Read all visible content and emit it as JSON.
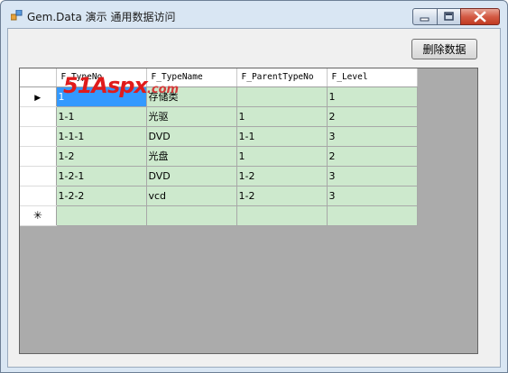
{
  "window": {
    "title": "Gem.Data 演示 通用数据访问",
    "icon": "app-icon",
    "controls": [
      "minimize-icon",
      "maximize-icon",
      "close-icon"
    ]
  },
  "toolbar": {
    "delete_label": "删除数据"
  },
  "grid": {
    "columns": [
      "F_TypeNo",
      "F_TypeName",
      "F_ParentTypeNo",
      "F_Level"
    ],
    "current_row_marker": "▶",
    "new_row_marker": "✳",
    "rows": [
      [
        "1",
        "存储类",
        "",
        "1"
      ],
      [
        "1-1",
        "光驱",
        "1",
        "2"
      ],
      [
        "1-1-1",
        "DVD",
        "1-1",
        "3"
      ],
      [
        "1-2",
        "光盘",
        "1",
        "2"
      ],
      [
        "1-2-1",
        "DVD",
        "1-2",
        "3"
      ],
      [
        "1-2-2",
        "vcd",
        "1-2",
        "3"
      ]
    ]
  },
  "watermark": {
    "brand": "51Aspx",
    "suffix": ".com"
  }
}
